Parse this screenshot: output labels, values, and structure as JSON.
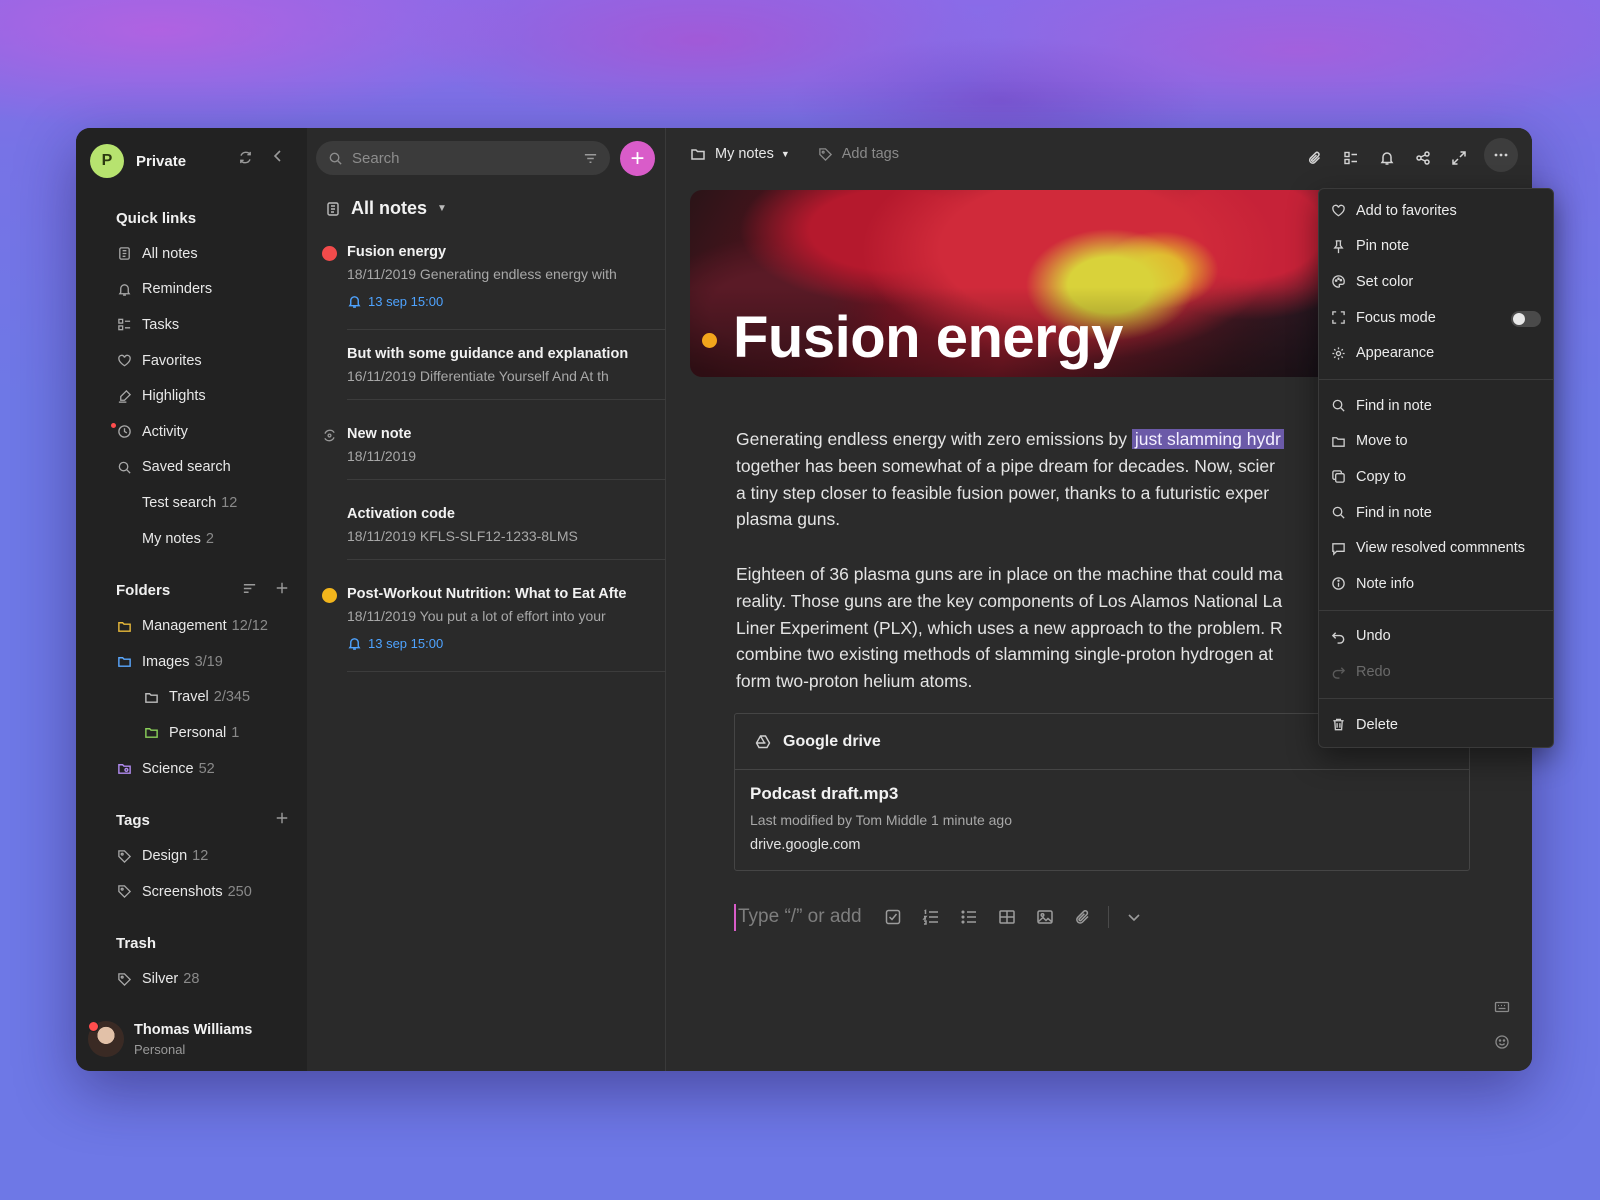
{
  "workspace": {
    "initial": "P",
    "name": "Private"
  },
  "sidebar": {
    "quick_links_title": "Quick links",
    "quick_links": [
      {
        "label": "All notes",
        "icon": "note-icon"
      },
      {
        "label": "Reminders",
        "icon": "bell-icon"
      },
      {
        "label": "Tasks",
        "icon": "tasks-icon"
      },
      {
        "label": "Favorites",
        "icon": "heart-icon"
      },
      {
        "label": "Highlights",
        "icon": "highlighter-icon"
      },
      {
        "label": "Activity",
        "icon": "clock-icon"
      },
      {
        "label": "Saved search",
        "icon": "search-icon"
      }
    ],
    "saved_searches": [
      {
        "label": "Test search",
        "count": "12"
      },
      {
        "label": "My notes",
        "count": "2"
      }
    ],
    "folders_title": "Folders",
    "folders": [
      {
        "label": "Management",
        "count": "12/12",
        "color": "#e8b93a"
      },
      {
        "label": "Images",
        "count": "3/19",
        "color": "#5aa8ff"
      },
      {
        "label": "Travel",
        "count": "2/345",
        "color": "#bdbdbd"
      },
      {
        "label": "Personal",
        "count": "1",
        "color": "#8bd05a"
      },
      {
        "label": "Science",
        "count": "52",
        "color": "#b18bf0"
      }
    ],
    "tags_title": "Tags",
    "tags": [
      {
        "label": "Design",
        "count": "12"
      },
      {
        "label": "Screenshots",
        "count": "250"
      }
    ],
    "trash_title": "Trash",
    "trash": [
      {
        "label": "Silver",
        "count": "28"
      }
    ],
    "user": {
      "name": "Thomas Williams",
      "plan": "Personal"
    }
  },
  "list": {
    "search_placeholder": "Search",
    "header": "All notes",
    "notes": [
      {
        "title": "Fusion energy",
        "sub": "18/11/2019 Generating endless energy with",
        "reminder": "13 sep 15:00",
        "marker": "#f24b4b"
      },
      {
        "title": "But with some guidance and explanation",
        "sub": "16/11/2019 Differentiate Yourself And At th"
      },
      {
        "title": "New note",
        "sub": "18/11/2019"
      },
      {
        "title": "Activation code",
        "sub": "18/11/2019 KFLS-SLF12-1233-8LMS"
      },
      {
        "title": "Post-Workout Nutrition: What to Eat Afte",
        "sub": "18/11/2019 You put a lot of effort into your",
        "reminder": "13 sep 15:00",
        "marker": "#f2b51c"
      }
    ]
  },
  "editor": {
    "breadcrumb": "My notes",
    "add_tags": "Add tags",
    "title": "Fusion energy",
    "p1_before": "Generating endless energy with zero emissions by",
    "p1_highlight": "just slamming hydr",
    "p1_after": "together has been somewhat of a pipe dream for decades. Now, scier\na tiny step closer to feasible fusion power, thanks to a futuristic exper\nplasma guns.",
    "p2": "Eighteen of 36 plasma guns are in place on the machine that could ma\nreality. Those guns are the key components of Los Alamos National La\nLiner Experiment (PLX), which uses a new approach to the problem. R\ncombine two existing methods of slamming single-proton hydrogen at\nform two-proton helium atoms.",
    "drive": {
      "title": "Google drive",
      "file": "Podcast draft.mp3",
      "meta": "Last modified by Tom Middle 1 minute ago",
      "url": "drive.google.com"
    },
    "composer_placeholder": "Type “/” or add"
  },
  "menu": {
    "group1": [
      {
        "label": "Add to favorites",
        "icon": "heart-icon"
      },
      {
        "label": "Pin note",
        "icon": "pin-icon"
      },
      {
        "label": "Set color",
        "icon": "palette-icon"
      },
      {
        "label": "Focus mode",
        "icon": "focus-icon"
      },
      {
        "label": "Appearance",
        "icon": "gear-icon"
      }
    ],
    "group2": [
      {
        "label": "Find in note",
        "icon": "search-icon"
      },
      {
        "label": "Move to",
        "icon": "folder-icon"
      },
      {
        "label": "Copy to",
        "icon": "copy-icon"
      },
      {
        "label": "Find in note",
        "icon": "search-icon"
      },
      {
        "label": "View resolved commnents",
        "icon": "comment-icon"
      },
      {
        "label": "Note info",
        "icon": "info-icon"
      }
    ],
    "group3": [
      {
        "label": "Undo",
        "icon": "undo-icon"
      },
      {
        "label": "Redo",
        "icon": "redo-icon"
      }
    ],
    "group4": [
      {
        "label": "Delete",
        "icon": "trash-icon"
      }
    ],
    "focus_mode_on": false
  }
}
